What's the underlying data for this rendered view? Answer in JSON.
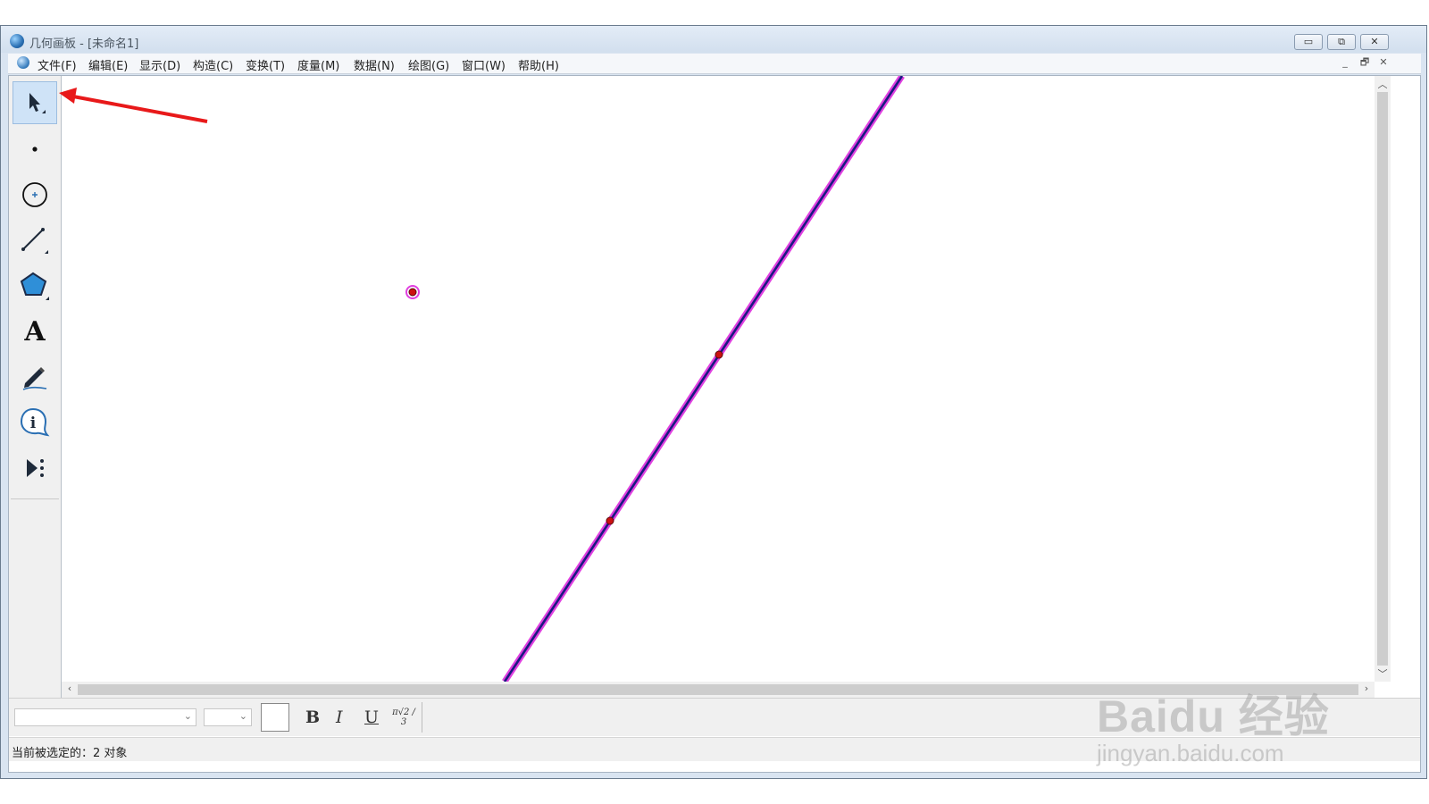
{
  "window": {
    "title": "几何画板 - [未命名1]",
    "controls": {
      "minimize": "▭",
      "restore": "⧉",
      "close": "✕"
    }
  },
  "menubar": {
    "items": [
      "文件(F)",
      "编辑(E)",
      "显示(D)",
      "构造(C)",
      "变换(T)",
      "度量(M)",
      "数据(N)",
      "绘图(G)",
      "窗口(W)",
      "帮助(H)"
    ],
    "mdi_controls": {
      "minimize": "_",
      "restore": "🗗",
      "close": "✕"
    }
  },
  "toolbox": {
    "tools": [
      {
        "name": "arrow-tool",
        "icon": "arrow-icon",
        "selected": true
      },
      {
        "name": "point-tool",
        "icon": "point-icon",
        "selected": false
      },
      {
        "name": "compass-tool",
        "icon": "circle-icon",
        "selected": false
      },
      {
        "name": "straightedge-tool",
        "icon": "segment-icon",
        "selected": false
      },
      {
        "name": "polygon-tool",
        "icon": "polygon-icon",
        "selected": false
      },
      {
        "name": "text-tool",
        "icon": "text-icon",
        "selected": false
      },
      {
        "name": "marker-tool",
        "icon": "pen-icon",
        "selected": false
      },
      {
        "name": "information-tool",
        "icon": "info-icon",
        "selected": false
      },
      {
        "name": "custom-tool",
        "icon": "play-icon",
        "selected": false
      }
    ],
    "text_tool_glyph": "A",
    "info_tool_glyph": "i"
  },
  "canvas": {
    "line_color": "#1a1a80",
    "selection_color": "#e040e0",
    "point_color": "#cc1111"
  },
  "annotation": {
    "arrow_color": "#e8191a"
  },
  "textbar": {
    "bold": "B",
    "italic": "I",
    "underline": "U",
    "math_symbol": "π√2 / 3"
  },
  "status": {
    "text": "当前被选定的：2 对象"
  },
  "watermark": {
    "brand": "Baidu 经验",
    "url": "jingyan.baidu.com"
  }
}
